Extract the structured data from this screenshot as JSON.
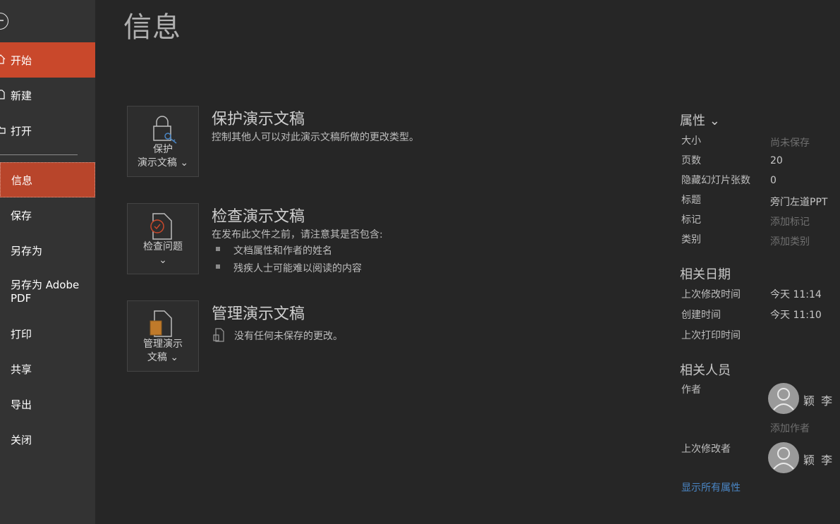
{
  "sidebar": {
    "items": [
      {
        "label": "开始"
      },
      {
        "label": "新建"
      },
      {
        "label": "打开"
      },
      {
        "label": "信息"
      },
      {
        "label": "保存"
      },
      {
        "label": "另存为"
      },
      {
        "label": "另存为 Adobe PDF"
      },
      {
        "label": "打印"
      },
      {
        "label": "共享"
      },
      {
        "label": "导出"
      },
      {
        "label": "关闭"
      }
    ]
  },
  "page_title": "信息",
  "sections": [
    {
      "tile_label": "保护\n演示文稿 ⌄",
      "title": "保护演示文稿",
      "desc": "控制其他人可以对此演示文稿所做的更改类型。"
    },
    {
      "tile_label": "检查问题\n⌄",
      "title": "检查演示文稿",
      "desc": "在发布此文件之前，请注意其是否包含:",
      "bullets": [
        "文档属性和作者的姓名",
        "残疾人士可能难以阅读的内容"
      ]
    },
    {
      "tile_label": "管理演示\n文稿 ⌄",
      "title": "管理演示文稿",
      "desc": "没有任何未保存的更改。"
    }
  ],
  "properties": {
    "heading": "属性 ⌄",
    "rows": [
      {
        "label": "大小",
        "value": "尚未保存"
      },
      {
        "label": "页数",
        "value": "20"
      },
      {
        "label": "隐藏幻灯片张数",
        "value": "0"
      },
      {
        "label": "标题",
        "value": "旁门左道PPT"
      },
      {
        "label": "标记",
        "value": "添加标记"
      },
      {
        "label": "类别",
        "value": "添加类别"
      }
    ]
  },
  "dates": {
    "heading": "相关日期",
    "rows": [
      {
        "label": "上次修改时间",
        "value": "今天 11:14"
      },
      {
        "label": "创建时间",
        "value": "今天 11:10"
      },
      {
        "label": "上次打印时间",
        "value": ""
      }
    ]
  },
  "people": {
    "heading": "相关人员",
    "author_label": "作者",
    "author_name": "颖 李",
    "add_author": "添加作者",
    "modifier_label": "上次修改者",
    "modifier_name": "颖 李"
  },
  "show_all": "显示所有属性",
  "colors": {
    "accent": "#c9482b",
    "link": "#4a86c5"
  }
}
